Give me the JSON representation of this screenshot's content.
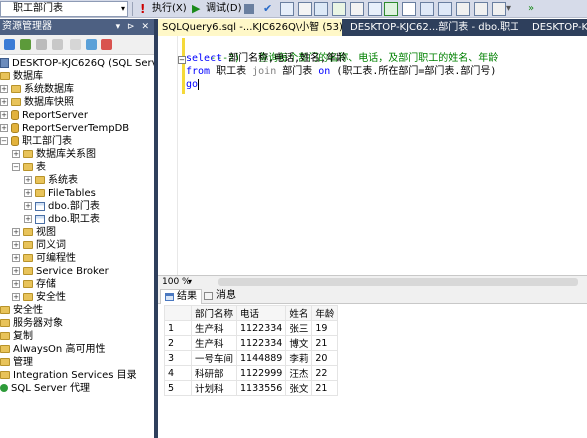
{
  "toolbar": {
    "database": "职工部门表",
    "execute_label": "执行(X)",
    "debug_label": "调试(D)"
  },
  "object_explorer": {
    "title": "资源管理器",
    "title_controls": "▾ ⊳ ✕",
    "tree": [
      {
        "label": "数据库",
        "level": 0
      },
      {
        "label": "系统数据库",
        "level": 1
      },
      {
        "label": "数据库快照",
        "level": 1
      },
      {
        "label": "ReportServer",
        "level": 1
      },
      {
        "label": "ReportServerTempDB",
        "level": 1
      },
      {
        "label": "职工部门表",
        "level": 1
      },
      {
        "label": "数据库关系图",
        "level": 2
      },
      {
        "label": "表",
        "level": 2
      },
      {
        "label": "系统表",
        "level": 3
      },
      {
        "label": "FileTables",
        "level": 3
      },
      {
        "label": "dbo.部门表",
        "level": 3
      },
      {
        "label": "dbo.职工表",
        "level": 3
      },
      {
        "label": "视图",
        "level": 2
      },
      {
        "label": "同义词",
        "level": 2
      },
      {
        "label": "可编程性",
        "level": 2
      },
      {
        "label": "Service Broker",
        "level": 2
      },
      {
        "label": "存储",
        "level": 2
      },
      {
        "label": "安全性",
        "level": 2
      },
      {
        "label": "安全性",
        "level": 0
      },
      {
        "label": "服务器对象",
        "level": 0
      },
      {
        "label": "复制",
        "level": 0
      },
      {
        "label": "AlwaysOn 高可用性",
        "level": 0
      },
      {
        "label": "管理",
        "level": 0
      },
      {
        "label": "Integration Services 目录",
        "level": 0
      },
      {
        "label": "SQL Server 代理",
        "level": 0
      }
    ],
    "server": "DESKTOP-KJC626Q (SQL Server 11.0."
  },
  "tabs": [
    {
      "label": "SQLQuery6.sql -...KJC626Q\\小智 (53))*",
      "close": "✕"
    },
    {
      "label": "DESKTOP-KJC62...部门表 - dbo.职工表"
    },
    {
      "label": "DESKTOP-KJC6"
    }
  ],
  "editor": {
    "lines": [
      {
        "comment": "---2)   查询每个部门的名称、电话，及部门职工的姓名、年龄"
      },
      {
        "kw": "select",
        "rest": " 部门名称,电话,姓名,年龄"
      },
      {
        "kw": "from",
        "rest": " 职工表 ",
        "kw2": "join",
        "rest2": " 部门表 ",
        "kw3": "on",
        "rest3": " (职工表.所在部门=部门表.部门号)"
      },
      {
        "kw": "go"
      }
    ]
  },
  "zoom": "100 %",
  "result_tabs": {
    "results": "结果",
    "messages": "消息"
  },
  "results": {
    "columns": [
      "部门名称",
      "电话",
      "姓名",
      "年龄"
    ],
    "rows": [
      [
        "1",
        "生产科",
        "1122334",
        "张三",
        "19"
      ],
      [
        "2",
        "生产科",
        "1122334",
        "博文",
        "21"
      ],
      [
        "3",
        "一号车间",
        "1144889",
        "李莉",
        "20"
      ],
      [
        "4",
        "科研部",
        "1122999",
        "汪杰",
        "22"
      ],
      [
        "5",
        "计划科",
        "1133556",
        "张文",
        "21"
      ]
    ]
  }
}
